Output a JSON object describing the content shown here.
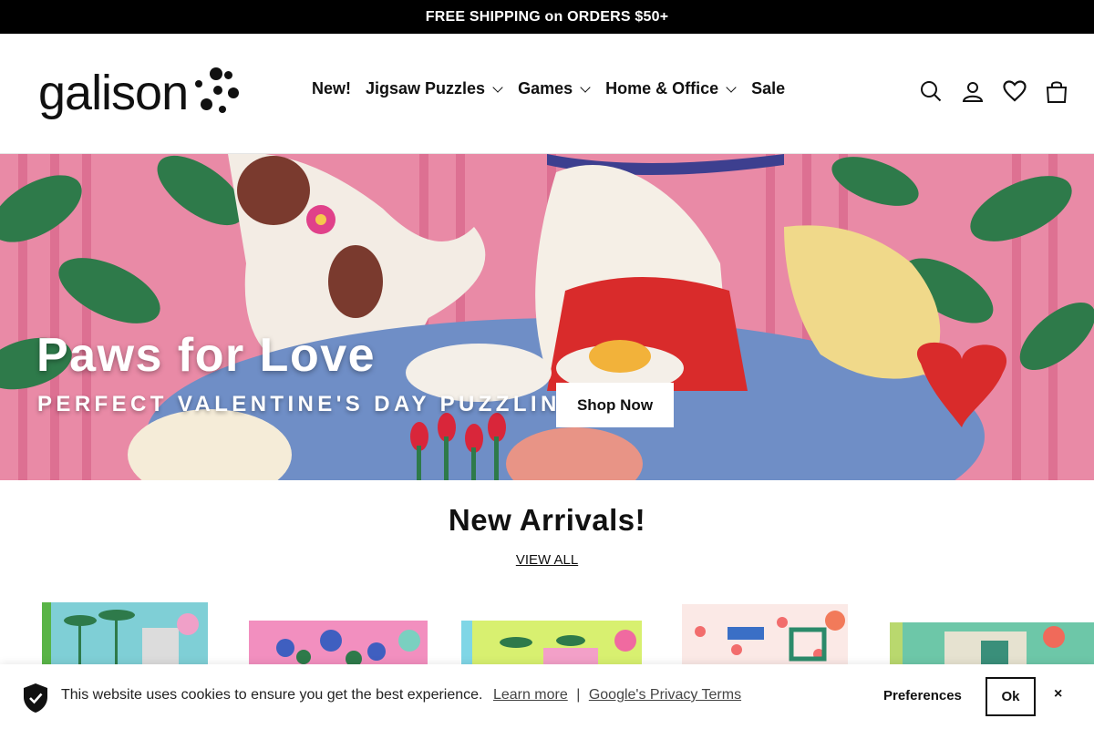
{
  "announcement": {
    "text": "FREE SHIPPING on ORDERS $50+"
  },
  "logo": {
    "text": "galison"
  },
  "nav": {
    "items": [
      {
        "label": "New!",
        "dropdown": false
      },
      {
        "label": "Jigsaw Puzzles",
        "dropdown": true
      },
      {
        "label": "Games",
        "dropdown": true
      },
      {
        "label": "Home & Office",
        "dropdown": true
      },
      {
        "label": "Sale",
        "dropdown": false
      }
    ]
  },
  "header_icons": [
    "search-icon",
    "account-icon",
    "wishlist-heart-icon",
    "cart-bag-icon"
  ],
  "hero": {
    "title": "Paws for Love",
    "subtitle": "PERFECT VALENTINE'S DAY PUZZLING",
    "button_label": "Shop Now"
  },
  "arrivals": {
    "title": "New Arrivals!",
    "view_all": "VIEW ALL"
  },
  "cookie": {
    "message": "This website uses cookies to ensure you get the best experience.",
    "learn_more": "Learn more",
    "separator": "|",
    "privacy": "Google's Privacy Terms",
    "preferences": "Preferences",
    "ok": "Ok",
    "close": "×"
  },
  "colors": {
    "announcement_bg": "#000000",
    "hero_pink": "#e98aa6",
    "table_blue": "#6f8ec6",
    "leaf_green": "#2e7a4a"
  }
}
